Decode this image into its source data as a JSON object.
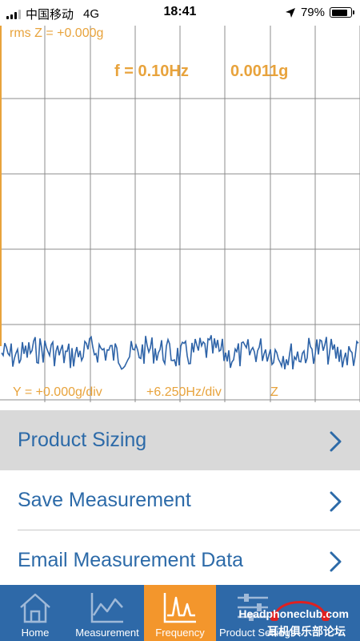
{
  "status_bar": {
    "carrier": "中国移动",
    "network": "4G",
    "time": "18:41",
    "battery": "79%",
    "icons": [
      "signal-bars-icon",
      "location-arrow-icon",
      "battery-icon"
    ]
  },
  "chart": {
    "rms_label": "rms Z = +0.000g",
    "frequency_label": "f = 0.10Hz",
    "amplitude_label": "0.0011g",
    "y_scale_label": "Y = +0.000g/div",
    "x_scale_label": "+6.250Hz/div",
    "axis_label": "Z",
    "colors": {
      "text": "#e8a33c",
      "grid": "#8c8c8c",
      "trace": "#2f64a8",
      "left_axis": "#e8a33c"
    }
  },
  "menu": {
    "items": [
      {
        "label": "Product Sizing",
        "selected": true,
        "icon": "chevron-right-icon"
      },
      {
        "label": "Save Measurement",
        "selected": false,
        "icon": "chevron-right-icon"
      },
      {
        "label": "Email Measurement Data",
        "selected": false,
        "icon": "chevron-right-icon"
      }
    ]
  },
  "tabbar": {
    "tabs": [
      {
        "label": "Home",
        "icon": "home-icon",
        "active": false
      },
      {
        "label": "Measurement",
        "icon": "line-chart-icon",
        "active": false
      },
      {
        "label": "Frequency",
        "icon": "frequency-chart-icon",
        "active": true
      },
      {
        "label": "Product Settings",
        "icon": "sliders-icon",
        "active": false
      }
    ],
    "colors": {
      "background": "#2e69a8",
      "active": "#f3962c"
    }
  },
  "watermark": {
    "text": "Headphoneclub.com",
    "text_cn": "耳机俱乐部论坛"
  }
}
